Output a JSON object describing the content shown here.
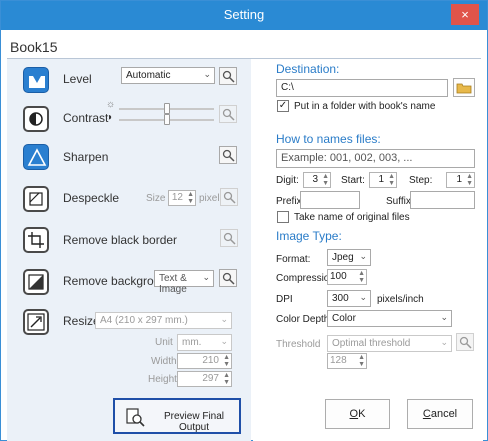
{
  "window": {
    "title": "Setting",
    "close_glyph": "×"
  },
  "book_name": "Book15",
  "left": {
    "level": {
      "label": "Level",
      "mode": "Automatic"
    },
    "contrast": {
      "label": "Contrast"
    },
    "sharpen": {
      "label": "Sharpen"
    },
    "despeckle": {
      "label": "Despeckle",
      "size_label": "Size",
      "size_value": "12",
      "unit": "pixel"
    },
    "remove_black_border": {
      "label": "Remove black border"
    },
    "remove_background": {
      "label": "Remove background",
      "mode": "Text & Image"
    },
    "resize": {
      "label": "Resize",
      "paper": "A4 (210 x 297 mm.)",
      "unit_label": "Unit",
      "unit_value": "mm.",
      "width_label": "Width",
      "width_value": "210",
      "height_label": "Height",
      "height_value": "297"
    },
    "preview_button": "Preview Final Output"
  },
  "right": {
    "destination": {
      "heading": "Destination:",
      "path": "C:\\",
      "folder_option": "Put in a folder with book's name",
      "folder_option_checked": true
    },
    "naming": {
      "heading": "How to names files:",
      "example": "Example: 001, 002, 003, ...",
      "digit_label": "Digit:",
      "digit_value": "3",
      "start_label": "Start:",
      "start_value": "1",
      "step_label": "Step:",
      "step_value": "1",
      "prefix_label": "Prefix",
      "prefix_value": "",
      "suffix_label": "Suffix",
      "suffix_value": "",
      "original_name_option": "Take name of original files",
      "original_name_checked": false
    },
    "image_type": {
      "heading": "Image Type:",
      "format_label": "Format:",
      "format_value": "Jpeg",
      "compression_label": "Compression:",
      "compression_value": "100",
      "dpi_label": "DPI",
      "dpi_value": "300",
      "dpi_unit": "pixels/inch",
      "color_depth_label": "Color Depth:",
      "color_depth_value": "Color",
      "threshold_label": "Threshold",
      "threshold_mode": "Optimal threshold",
      "threshold_value": "128"
    },
    "ok_button": {
      "label_rest": "K",
      "accel": "O"
    },
    "cancel_button": {
      "label_rest": "ancel",
      "accel": "C"
    }
  },
  "icons": {
    "level": "level-icon",
    "contrast": "contrast-icon",
    "sharpen": "sharpen-icon",
    "despeckle": "despeckle-icon",
    "remove_black_border": "crop-icon",
    "remove_background": "background-icon",
    "resize": "resize-icon",
    "search": "magnifier-icon",
    "folder": "folder-icon"
  },
  "colors": {
    "title_bar": "#2a8ad4",
    "close_button": "#e0544a",
    "left_panel": "#ebf1f8",
    "heading_blue": "#2a7cc8",
    "preview_border": "#1f4fa8"
  }
}
